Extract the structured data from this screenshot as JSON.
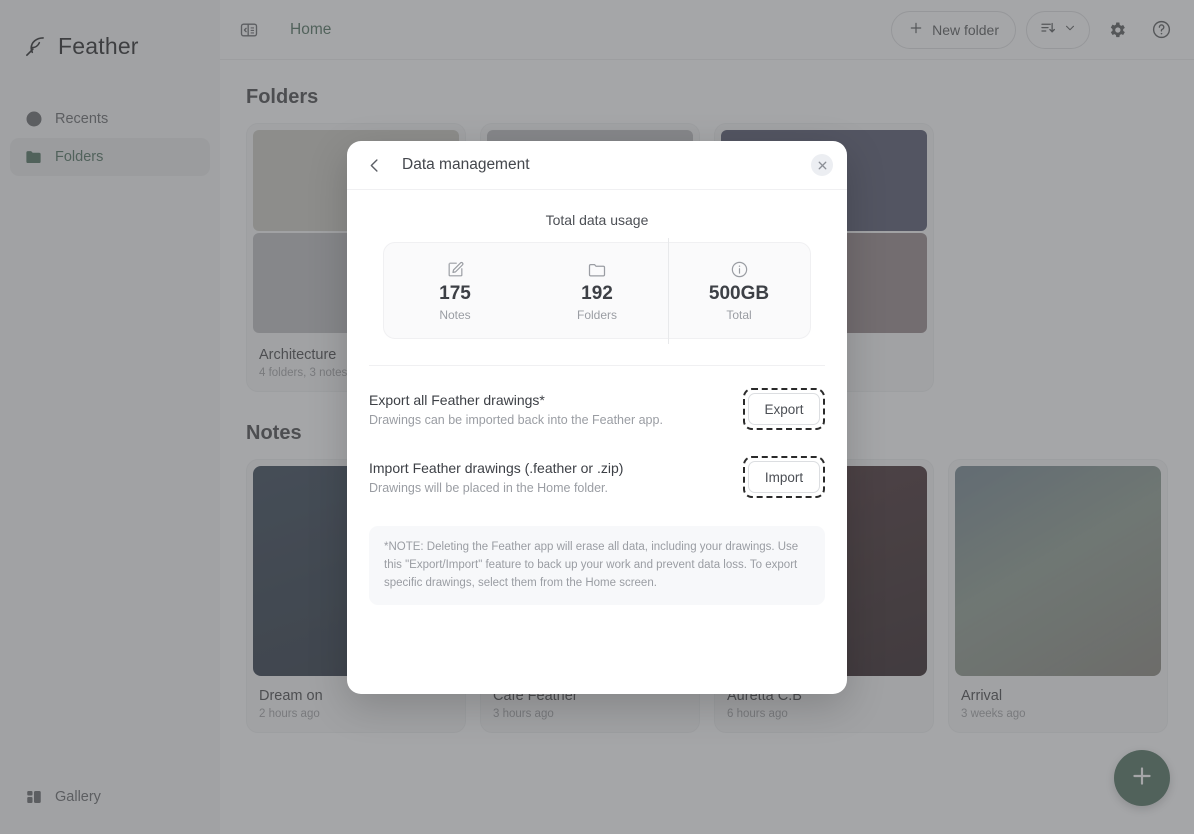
{
  "app": {
    "brand": "Feather",
    "brand_logo_icon": "feather-icon"
  },
  "sidebar": {
    "items": [
      {
        "label": "Recents",
        "icon": "clock-icon",
        "active": false
      },
      {
        "label": "Folders",
        "icon": "folder-icon",
        "active": true
      }
    ],
    "bottom": {
      "label": "Gallery",
      "icon": "gallery-grid-icon"
    }
  },
  "topbar": {
    "panel_toggle_icon": "sidebar-toggle-icon",
    "breadcrumb": "Home",
    "new_folder_label": "New folder",
    "new_folder_icon": "plus-icon",
    "sort_icon": "sort-descending-icon",
    "sort_chevron_icon": "chevron-down-icon",
    "settings_icon": "gear-icon",
    "help_icon": "question-circle-icon"
  },
  "content": {
    "folders_heading": "Folders",
    "notes_heading": "Notes",
    "folders": [
      {
        "name": "Architecture",
        "meta": "4 folders, 3 notes",
        "thumb_top": "#cfc9a6",
        "thumb_bottom": "#b9bcc0"
      },
      {
        "name": "",
        "meta": "",
        "thumb_top": "#b8bbbf",
        "thumb_bottom": "#c3c6ca"
      },
      {
        "name": "",
        "meta": "",
        "thumb_top": "#3f4a9b",
        "thumb_bottom": "#a87b80"
      }
    ],
    "notes": [
      {
        "title": "Dream on",
        "time": "2 hours ago",
        "thumb": "#0f3f73"
      },
      {
        "title": "Cafe Feather",
        "time": "3 hours ago",
        "thumb": "#6b7c8c"
      },
      {
        "title": "Auretta C.B",
        "time": "6 hours ago",
        "thumb": "#5c1420"
      },
      {
        "title": "Arrival",
        "time": "3 weeks ago",
        "thumb": "#3f7fa0"
      }
    ],
    "fab_icon": "plus-icon"
  },
  "modal": {
    "back_icon": "chevron-left-icon",
    "title": "Data management",
    "close_icon": "close-icon",
    "usage_heading": "Total data usage",
    "stats": [
      {
        "icon": "note-edit-icon",
        "value": "175",
        "label": "Notes"
      },
      {
        "icon": "folder-outline-icon",
        "value": "192",
        "label": "Folders"
      },
      {
        "icon": "info-circle-icon",
        "value": "500GB",
        "label": "Total"
      }
    ],
    "actions": [
      {
        "title": "Export all Feather drawings*",
        "subtitle": "Drawings can be imported back into the Feather app.",
        "button": "Export"
      },
      {
        "title": "Import Feather drawings (.feather or .zip)",
        "subtitle": "Drawings will be placed in the Home folder.",
        "button": "Import"
      }
    ],
    "note": "*NOTE: Deleting the Feather app will erase all data, including your drawings. Use this \"Export/Import\" feature to back up your work and prevent data loss. To export specific drawings, select them from the Home screen."
  },
  "colors": {
    "accent_green": "#0e7a40",
    "fab_green": "#0e7a3f",
    "text_dark": "#3d4046",
    "text_muted": "#9a9da3"
  }
}
